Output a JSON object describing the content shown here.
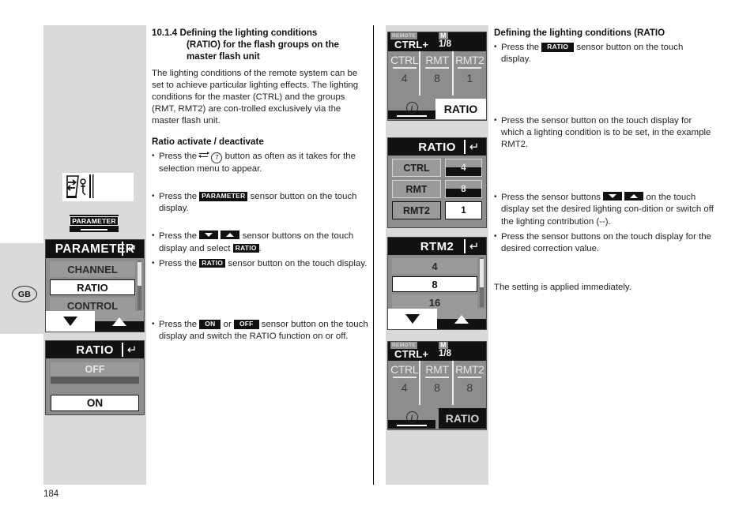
{
  "page": {
    "number": "184",
    "locale_badge": "GB"
  },
  "left_column": {
    "section_heading": {
      "number": "10.1.4",
      "line1": "Defining the lighting conditions",
      "line2": "(RATIO) for the flash groups on the",
      "line3": "master flash unit"
    },
    "intro_paragraph": "The lighting conditions of the remote system can be set to achieve particular lighting effects. The lighting conditions for the master (CTRL) and the groups (RMT, RMT2) are con-trolled exclusively via the master flash unit.",
    "sub_heading": "Ratio activate / deactivate",
    "bullets": [
      {
        "pre": "Press the",
        "icon": "swap-button-icon",
        "ref": "7",
        "post": "button as often as it takes for the selection menu to appear."
      },
      {
        "pre": "Press the",
        "key": "PARAMETER",
        "post": "sensor button on the touch display."
      },
      {
        "pre": "Press the",
        "key_down": "arrow-down",
        "key_up": "arrow-up",
        "mid": "sensor buttons on the touch display and select",
        "key2": "RATIO",
        "post": "."
      },
      {
        "pre": "Press the",
        "key": "RATIO",
        "post": "sensor button on the touch display."
      },
      {
        "pre": "Press the",
        "key_on": "ON",
        "or": "or",
        "key_off": "OFF",
        "post": "sensor button on the touch display and switch the RATIO function  on or off."
      }
    ]
  },
  "right_column": {
    "heading": "Defining the lighting conditions (RATIO",
    "bullets": [
      {
        "pre": "Press the",
        "key": "RATIO",
        "post": "sensor button on the touch display."
      },
      {
        "text": "Press the sensor button on the touch display for which a lighting condition is to be set, in the example RMT2."
      },
      {
        "pre": "Press the sensor buttons",
        "key_down": "arrow-down",
        "key_up": "arrow-up",
        "post": "on the touch display set the desired lighting con-dition or switch off the lighting contribution (--)."
      },
      {
        "text": "Press the sensor buttons on the touch display for the desired correction value."
      }
    ],
    "closing_note": "The setting is applied immediately."
  },
  "left_graphics": {
    "flash_icon_name": "flash-unit-remote-icon",
    "parameter_key": {
      "label": "PARAMETER"
    },
    "lcd_parameter_menu": {
      "title": "PARAMETER",
      "return_icon": "return-arrow-icon",
      "items": [
        {
          "label": "CHANNEL",
          "selected": false
        },
        {
          "label": "RATIO",
          "selected": true
        },
        {
          "label": "CONTROL",
          "selected": false
        }
      ],
      "buttons": [
        {
          "name": "down-arrow-button",
          "glyph": "down"
        },
        {
          "name": "up-arrow-button",
          "glyph": "up"
        }
      ]
    },
    "lcd_ratio_onoff": {
      "title": "RATIO",
      "return_icon": "return-arrow-icon",
      "options": [
        {
          "label": "OFF",
          "selected": false
        },
        {
          "label": "ON",
          "selected": true
        }
      ]
    }
  },
  "mid_graphics": {
    "lcd_overview_top": {
      "remote_label": "REMOTE",
      "mode_label": "CTRL+",
      "m_label": "M",
      "power": "1/8",
      "groups": [
        {
          "name": "CTRL",
          "value": "4"
        },
        {
          "name": "RMT",
          "value": "8"
        },
        {
          "name": "RMT2",
          "value": "1"
        }
      ],
      "info_icon": "info-circle-icon",
      "ratio_button": "RATIO",
      "ratio_highlighted": true
    },
    "lcd_ratio_list": {
      "title": "RATIO",
      "return_icon": "return-arrow-icon",
      "rows": [
        {
          "name": "CTRL",
          "value": "4",
          "selected": false
        },
        {
          "name": "RMT",
          "value": "8",
          "selected": false
        },
        {
          "name": "RMT2",
          "value": "1",
          "selected": true
        }
      ]
    },
    "lcd_rtm2": {
      "title": "RTM2",
      "return_icon": "return-arrow-icon",
      "items": [
        {
          "label": "4",
          "selected": false
        },
        {
          "label": "8",
          "selected": true
        },
        {
          "label": "16",
          "selected": false
        }
      ],
      "buttons": [
        {
          "name": "down-arrow-button",
          "glyph": "down"
        },
        {
          "name": "up-arrow-button",
          "glyph": "up"
        }
      ]
    },
    "lcd_overview_bottom": {
      "remote_label": "REMOTE",
      "mode_label": "CTRL+",
      "m_label": "M",
      "power": "1/8",
      "groups": [
        {
          "name": "CTRL",
          "value": "4"
        },
        {
          "name": "RMT",
          "value": "8"
        },
        {
          "name": "RMT2",
          "value": "8"
        }
      ],
      "info_icon": "info-circle-icon",
      "ratio_button": "RATIO",
      "ratio_highlighted": false
    }
  },
  "colors": {
    "column_gray": "#d9d9d9",
    "lcd_body": "#8d8d8d",
    "lcd_dark": "#111111",
    "lcd_row_gray": "#9a9a9a",
    "text": "#232323"
  }
}
